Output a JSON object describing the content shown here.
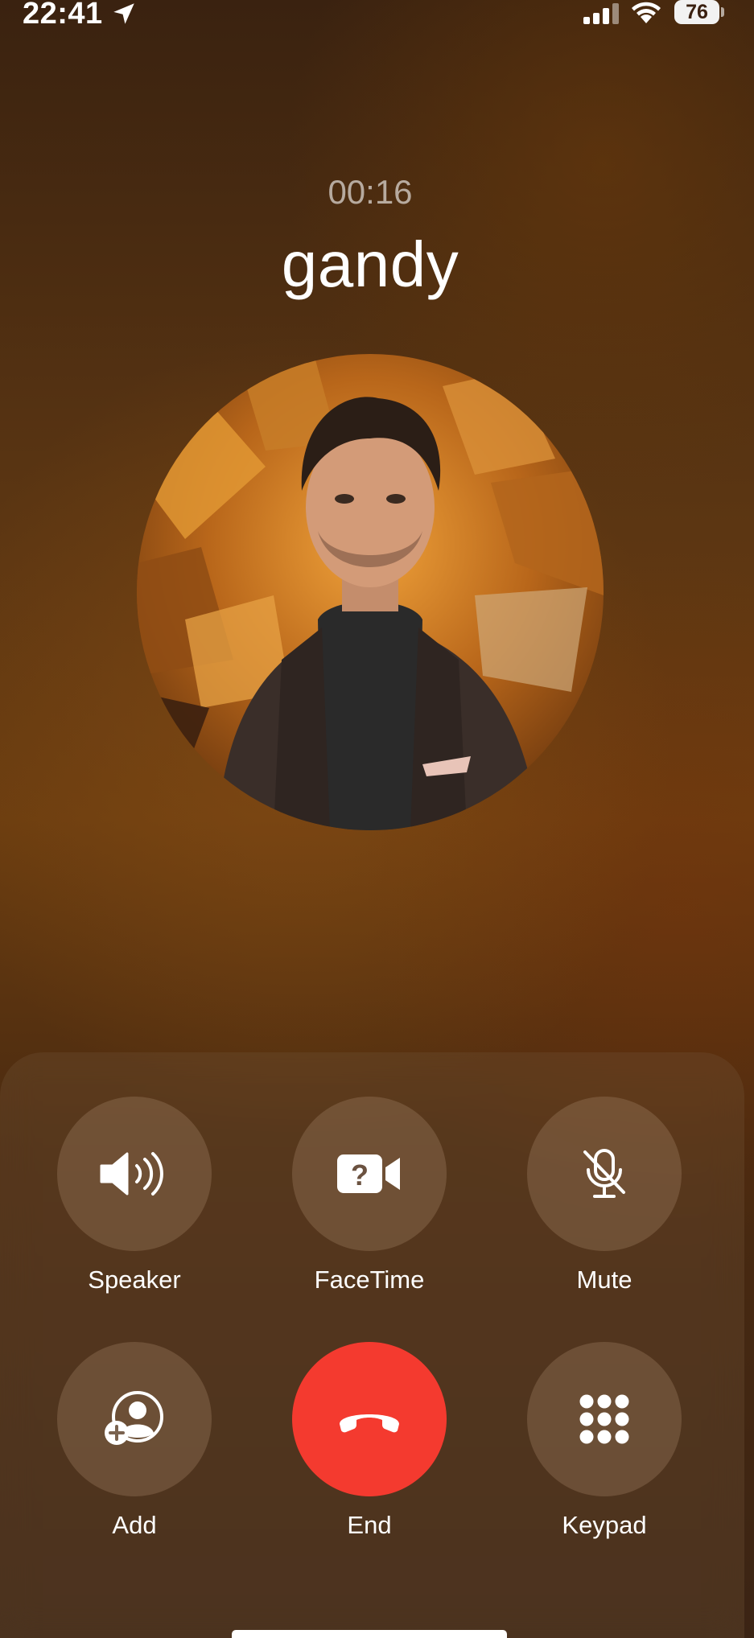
{
  "status_bar": {
    "time": "22:41",
    "battery": "76",
    "icons": [
      "location-arrow-icon",
      "cellular-signal-icon",
      "wifi-icon",
      "battery-icon"
    ]
  },
  "call": {
    "duration": "00:16",
    "caller_name": "gandy"
  },
  "controls": {
    "speaker": {
      "label": "Speaker",
      "icon": "speaker-icon"
    },
    "facetime": {
      "label": "FaceTime",
      "icon": "facetime-unavailable-icon"
    },
    "mute": {
      "label": "Mute",
      "icon": "mic-muted-icon"
    },
    "add": {
      "label": "Add",
      "icon": "add-person-icon"
    },
    "end": {
      "label": "End",
      "icon": "end-call-icon"
    },
    "keypad": {
      "label": "Keypad",
      "icon": "keypad-icon"
    }
  },
  "colors": {
    "end_button": "#f43a2f",
    "background": "#5a3512"
  }
}
